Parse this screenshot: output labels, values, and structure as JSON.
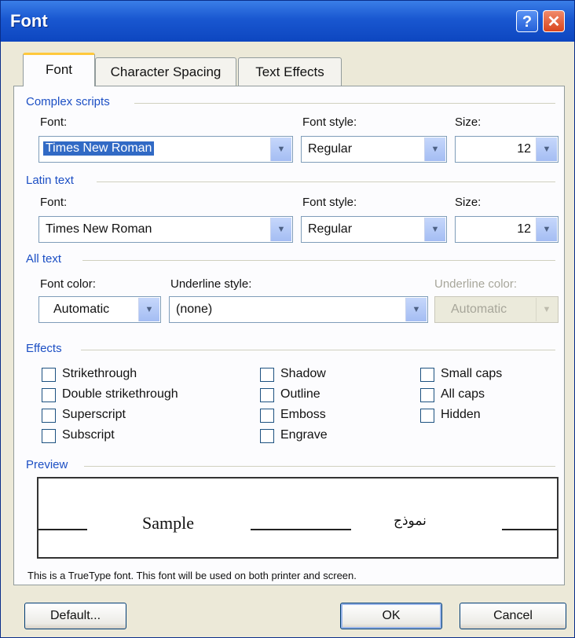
{
  "window": {
    "title": "Font",
    "help": "?",
    "close": "✕"
  },
  "tabs": [
    {
      "label": "Font",
      "active": true
    },
    {
      "label": "Character Spacing",
      "active": false
    },
    {
      "label": "Text Effects",
      "active": false
    }
  ],
  "complex_scripts": {
    "heading": "Complex scripts",
    "font_label": "Font:",
    "font_value": "Times New Roman",
    "style_label": "Font style:",
    "style_value": "Regular",
    "size_label": "Size:",
    "size_value": "12"
  },
  "latin_text": {
    "heading": "Latin text",
    "font_label": "Font:",
    "font_value": "Times New Roman",
    "style_label": "Font style:",
    "style_value": "Regular",
    "size_label": "Size:",
    "size_value": "12"
  },
  "all_text": {
    "heading": "All text",
    "color_label": "Font color:",
    "color_value": "Automatic",
    "underline_label": "Underline style:",
    "underline_value": "(none)",
    "underline_color_label": "Underline color:",
    "underline_color_value": "Automatic"
  },
  "effects": {
    "heading": "Effects",
    "col1": [
      "Strikethrough",
      "Double strikethrough",
      "Superscript",
      "Subscript"
    ],
    "col2": [
      "Shadow",
      "Outline",
      "Emboss",
      "Engrave"
    ],
    "col3": [
      "Small caps",
      "All caps",
      "Hidden"
    ]
  },
  "preview": {
    "heading": "Preview",
    "sample_latin": "Sample",
    "sample_arabic": "نموذج"
  },
  "note": "This is a TrueType font. This font will be used on both printer and screen.",
  "buttons": {
    "default": "Default...",
    "ok": "OK",
    "cancel": "Cancel"
  },
  "colors": {
    "titlebar": "#1957d0",
    "group_heading": "#1c4fc4",
    "selection": "#316ac5",
    "tab_highlight": "#ffc83c"
  }
}
